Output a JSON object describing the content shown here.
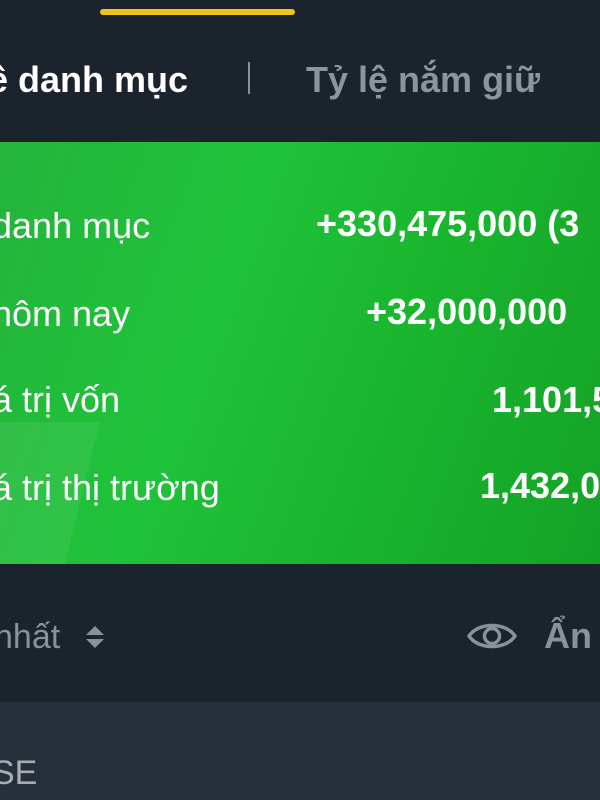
{
  "tabs": {
    "active_label": "ề danh mục",
    "divider": "|",
    "inactive_label": "Tỷ lệ nắm giữ"
  },
  "summary": {
    "rows": [
      {
        "label": "danh mục",
        "value": "+330,475,000 (3"
      },
      {
        "label": "hôm nay",
        "value": "+32,000,000"
      },
      {
        "label": "á trị vốn",
        "value": "1,101,5"
      },
      {
        "label": "á trị thị trường",
        "value": "1,432,0"
      }
    ]
  },
  "filter_bar": {
    "sort_label": "nhất",
    "sort_icon": "sort-updown-icon",
    "eye_icon": "eye-icon",
    "hide_label": "Ẩn"
  },
  "list": {
    "first_item_symbol": "SE"
  },
  "colors": {
    "background": "#1b232c",
    "tab_indicator": "#f0c419",
    "card_green": "#1fc33a",
    "muted_text": "#8a9299"
  }
}
